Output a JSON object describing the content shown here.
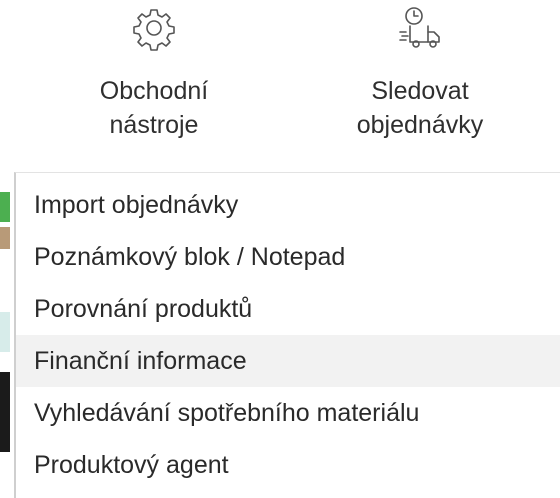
{
  "top_actions": [
    {
      "label": "Obchodní\nnástroje",
      "icon": "gear-icon"
    },
    {
      "label": "Sledovat\nobjednávky",
      "icon": "delivery-truck-clock-icon"
    }
  ],
  "menu": {
    "items": [
      {
        "label": "Import objednávky"
      },
      {
        "label": "Poznámkový blok / Notepad"
      },
      {
        "label": "Porovnání produktů"
      },
      {
        "label": "Finanční informace",
        "highlighted": true
      },
      {
        "label": "Vyhledávání spotřebního materiálu"
      },
      {
        "label": "Produktový agent"
      }
    ],
    "hover_color": "#f2f2f2"
  },
  "colors": {
    "text": "#2f2f2f",
    "icon_stroke": "#555555",
    "edge_green": "#4caf50",
    "edge_teal": "#5ab0a8"
  }
}
